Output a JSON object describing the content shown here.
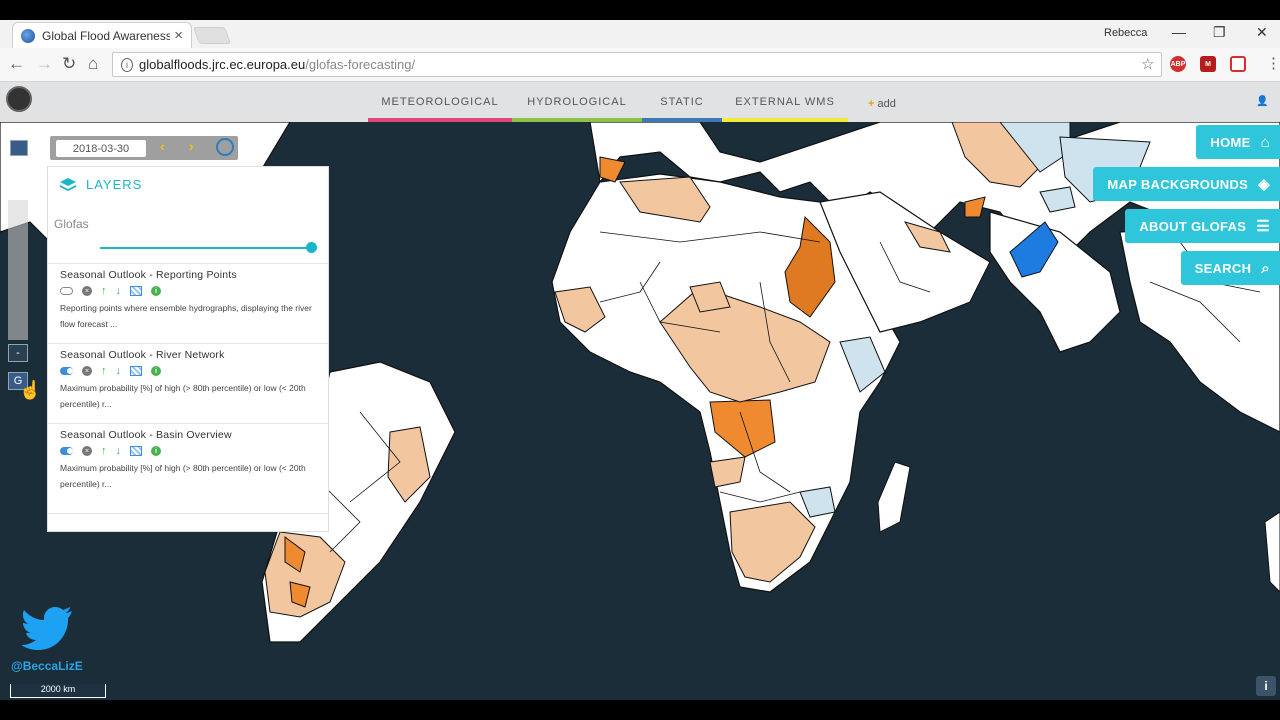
{
  "browser": {
    "tab_title": "Global Flood Awareness",
    "tab_close": "×",
    "profile_name": "Rebecca",
    "url_host": "globalfloods.jrc.ec.europa.eu",
    "url_path": "/glofas-forecasting/",
    "ext_abp": "ABP",
    "ext_m": "M"
  },
  "nav": {
    "tabs": [
      {
        "label": "METEOROLOGICAL",
        "color": "#e0457b"
      },
      {
        "label": "HYDROLOGICAL",
        "color": "#8bc34a"
      },
      {
        "label": "STATIC",
        "color": "#3c79b5"
      },
      {
        "label": "EXTERNAL WMS",
        "color": "#f0ea3a"
      }
    ],
    "add_label": "add"
  },
  "date": {
    "value": "2018-03-30",
    "prev": "‹",
    "next": "›"
  },
  "controls": {
    "zoom_out": "-",
    "layers_btn": "G"
  },
  "layers_panel": {
    "title": "LAYERS",
    "group": "Glofas",
    "items": [
      {
        "name": "Seasonal Outlook - Reporting Points",
        "desc": "Reporting points where ensemble hydrographs, displaying the river flow forecast ...",
        "enabled": false
      },
      {
        "name": "Seasonal Outlook - River Network",
        "desc": "Maximum probability [%] of high (> 80th percentile) or low (< 20th percentile) r...",
        "enabled": true
      },
      {
        "name": "Seasonal Outlook - Basin Overview",
        "desc": "Maximum probability [%] of high (> 80th percentile) or low (< 20th percentile) r...",
        "enabled": true
      }
    ]
  },
  "right_menu": {
    "home": "HOME",
    "map_backgrounds": "MAP BACKGROUNDS",
    "about": "ABOUT GLOFAS",
    "search": "SEARCH"
  },
  "overlay": {
    "twitter_handle": "@BeccaLizE",
    "scale": "2000 km",
    "info": "i"
  },
  "colors": {
    "accent": "#2fc6dc",
    "high_prob_dark": "#e07a22",
    "high_prob_mid": "#ef8a30",
    "high_prob_light": "#f2c7a0",
    "low_prob_blue": "#1e7be0",
    "low_prob_light": "#cfe3ee",
    "ocean": "#1b2d39"
  }
}
